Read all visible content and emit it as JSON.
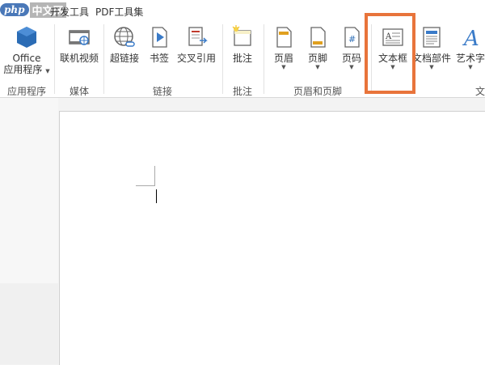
{
  "watermark": {
    "badge": "php",
    "text": "中文网"
  },
  "tabs": [
    {
      "label": "开发工具"
    },
    {
      "label": "PDF工具集"
    }
  ],
  "groups": {
    "apps": "应用程序",
    "media": "媒体",
    "links": "链接",
    "comments": "批注",
    "header_footer": "页眉和页脚",
    "text_partial": "文"
  },
  "buttons": {
    "office_line1": "Office",
    "office_line2": "应用程序",
    "online_video": "联机视频",
    "hyperlink": "超链接",
    "bookmark": "书签",
    "cross_ref": "交叉引用",
    "comment": "批注",
    "header": "页眉",
    "footer": "页脚",
    "page_number": "页码",
    "textbox": "文本框",
    "quick_parts": "文档部件",
    "wordart": "艺术字"
  },
  "colors": {
    "highlight": "#e8743b",
    "office_blue": "#2b6cb5",
    "accent": "#4a78b8"
  }
}
